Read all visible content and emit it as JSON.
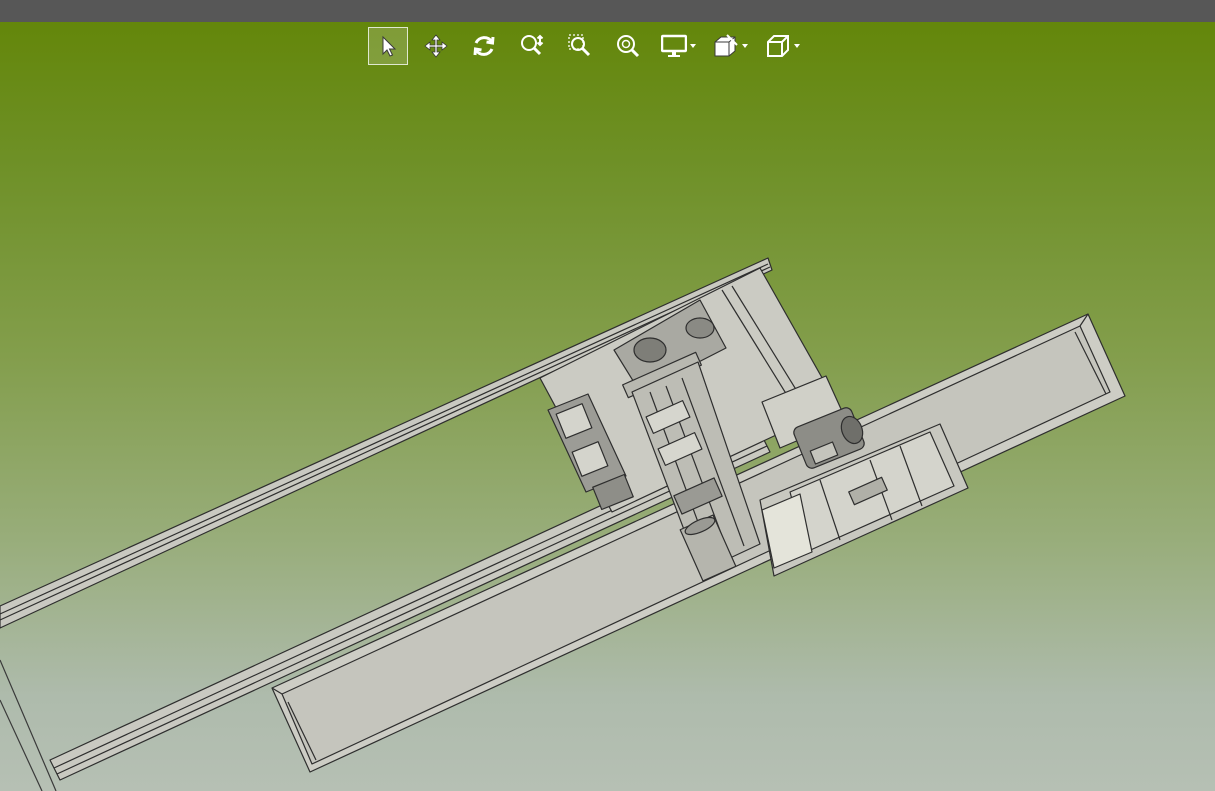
{
  "toolbar": {
    "tools": [
      {
        "icon": "select-arrow-icon",
        "active": true
      },
      {
        "icon": "pan-icon"
      },
      {
        "icon": "rotate-icon"
      },
      {
        "icon": "zoom-dynamic-icon"
      },
      {
        "icon": "zoom-window-icon"
      },
      {
        "icon": "zoom-fit-icon"
      },
      {
        "icon": "display-monitor-icon",
        "dropdown": true
      },
      {
        "icon": "section-box-icon",
        "dropdown": true
      },
      {
        "icon": "view-cube-icon",
        "dropdown": true
      }
    ]
  },
  "viewport": {
    "background_top": "#628506",
    "background_bottom": "#b6c0b4",
    "model_fill": "#cbcbc3",
    "model_edge": "#2e2e2e"
  }
}
